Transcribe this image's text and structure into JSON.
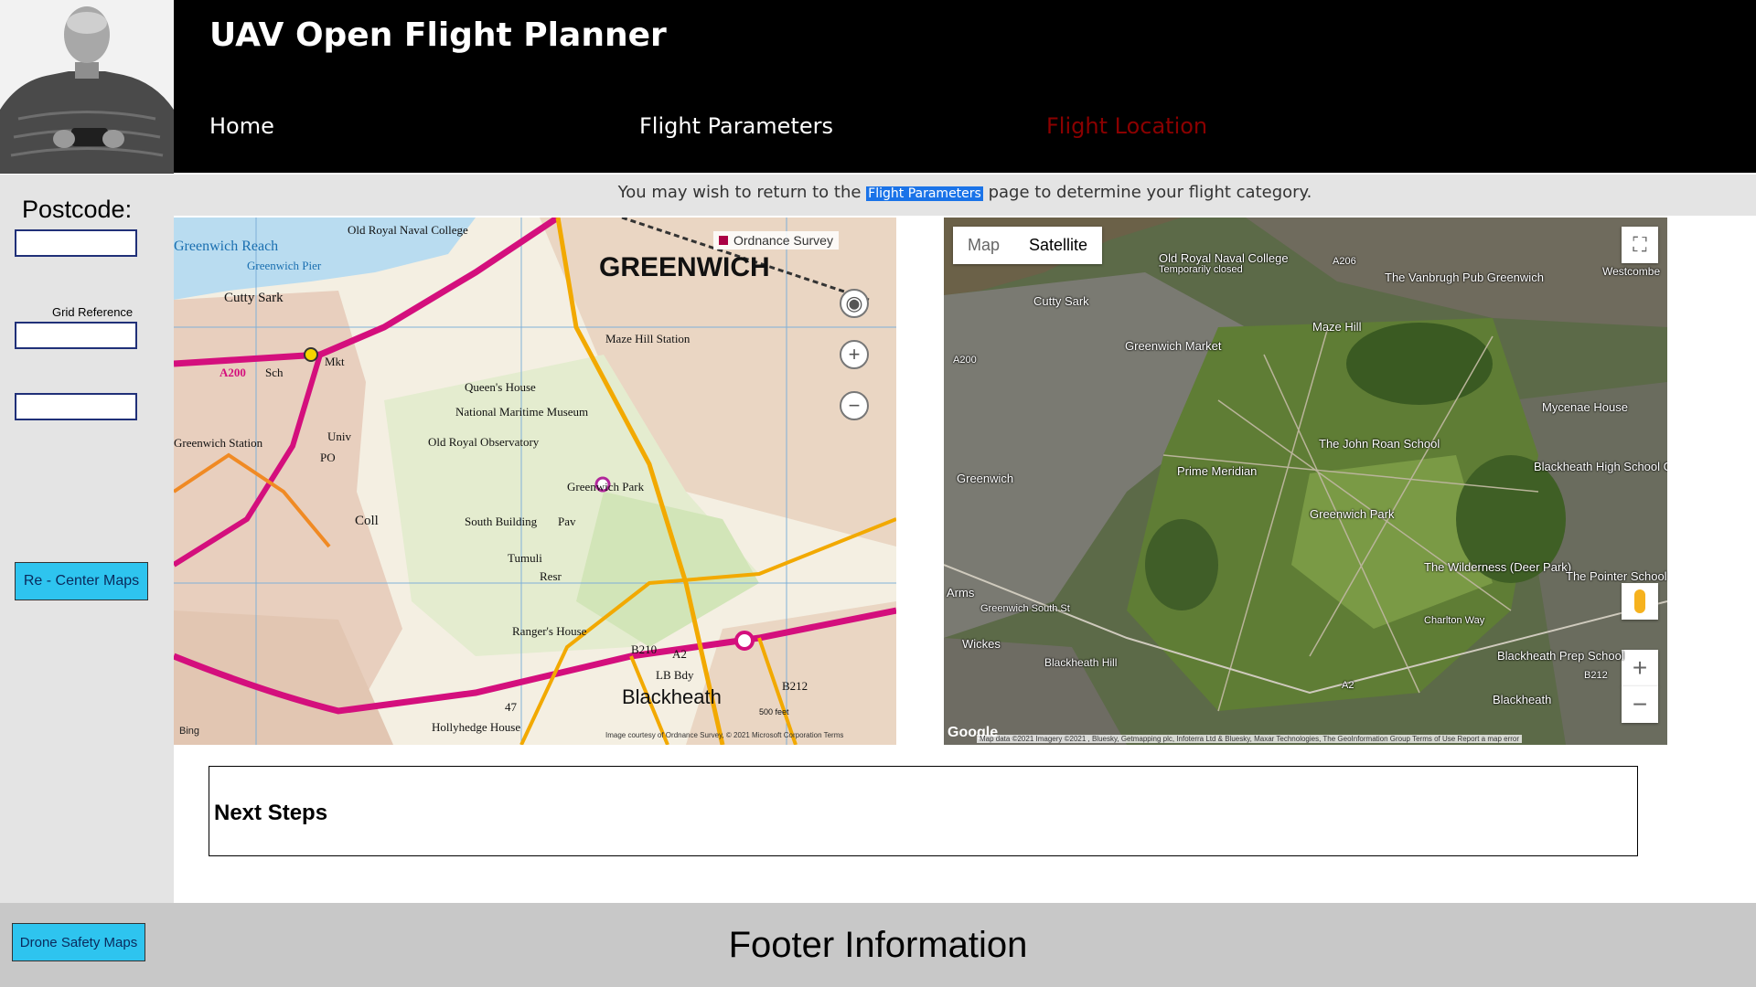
{
  "header": {
    "title": "UAV Open Flight Planner",
    "nav": [
      "Home",
      "Flight Parameters",
      "Flight Location"
    ]
  },
  "notice": {
    "before": "You may wish to return to the",
    "link": "Flight Parameters",
    "after": "page to determine your flight category."
  },
  "sidebar": {
    "postcode_label": "Postcode:",
    "grid_label": "Grid Reference",
    "recenter_button": "Re - Center Maps"
  },
  "os_map": {
    "labels": [
      "Old Royal Naval College",
      "Greenwich Reach",
      "Greenwich Pier",
      "Cutty Sark",
      "GREENWICH",
      "Maze Hill Station",
      "Queen's House",
      "National Maritime Museum",
      "Old Royal Observatory",
      "Greenwich Park",
      "South Building",
      "Tumuli",
      "Pav",
      "Resr",
      "Ranger's House",
      "Blackheath",
      "LB Bdy",
      "Hollyhedge House",
      "Greenwich Station",
      "Univ",
      "PO",
      "Coll",
      "Sch",
      "Mkt",
      "A200",
      "A2",
      "B210",
      "B212",
      "47",
      "500 feet"
    ],
    "attribution_provider": "Ordnance Survey",
    "credit": "Image courtesy of Ordnance Survey, © 2021 Microsoft Corporation  Terms",
    "logo": "Bing"
  },
  "sat_map": {
    "map_tab": "Map",
    "satellite_tab": "Satellite",
    "labels": [
      "Old Royal Naval College",
      "Temporarily closed",
      "The Vanbrugh Pub Greenwich",
      "Westcombe",
      "Cutty Sark",
      "Maze Hill",
      "Greenwich Market",
      "Mycenae House",
      "The John Roan School",
      "Prime Meridian",
      "Blackheath High School GDST",
      "Greenwich",
      "Greenwich Park",
      "The Wilderness (Deer Park)",
      "The Pointer School",
      "Arms",
      "Greenwich South St",
      "Wickes",
      "Blackheath Hill",
      "Blackheath Prep School",
      "Blackheath",
      "A200",
      "A206",
      "A2",
      "B212",
      "Charlton Way"
    ],
    "attribution": "Map data ©2021 Imagery ©2021 , Bluesky, Getmapping plc, Infoterra Ltd & Bluesky, Maxar Technologies, The GeoInformation Group  Terms of Use  Report a map error",
    "logo": "Google"
  },
  "next_steps": {
    "title": "Next Steps"
  },
  "footer": {
    "safety_button": "Drone Safety Maps",
    "text": "Footer Information"
  }
}
